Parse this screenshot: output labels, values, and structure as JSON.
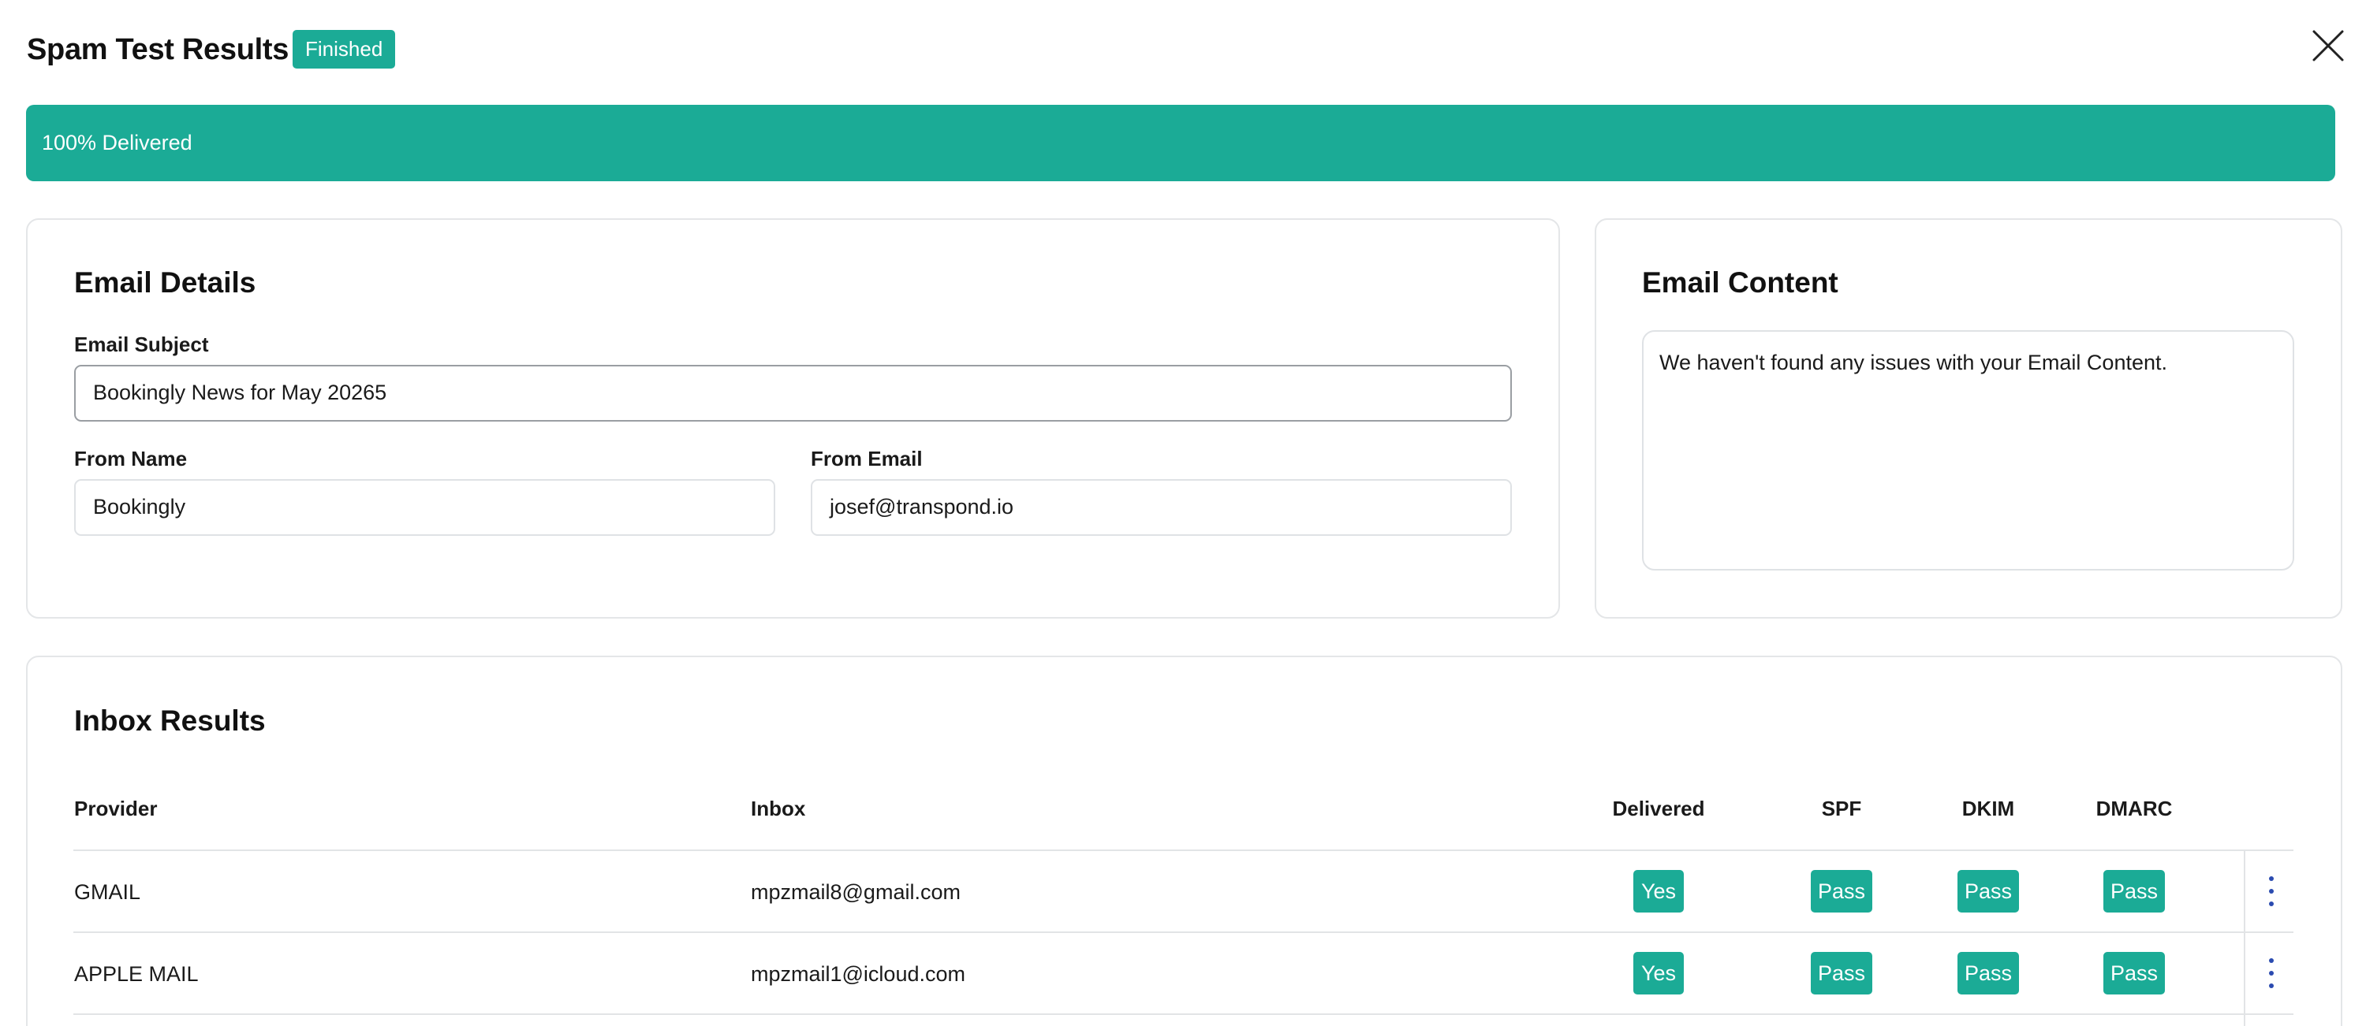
{
  "header": {
    "title": "Spam Test Results",
    "status_badge": "Finished"
  },
  "banner": {
    "text": "100% Delivered",
    "delivered_percent": 100
  },
  "email_details": {
    "title": "Email Details",
    "subject_label": "Email Subject",
    "subject_value": "Bookingly News for May 20265",
    "from_name_label": "From Name",
    "from_name_value": "Bookingly",
    "from_email_label": "From Email",
    "from_email_value": "josef@transpond.io"
  },
  "email_content": {
    "title": "Email Content",
    "message": "We haven't found any issues with your Email Content."
  },
  "inbox_results": {
    "title": "Inbox Results",
    "columns": {
      "provider": "Provider",
      "inbox": "Inbox",
      "delivered": "Delivered",
      "spf": "SPF",
      "dkim": "DKIM",
      "dmarc": "DMARC"
    },
    "rows": [
      {
        "provider": "GMAIL",
        "inbox": "mpzmail8@gmail.com",
        "delivered": "Yes",
        "spf": "Pass",
        "dkim": "Pass",
        "dmarc": "Pass"
      },
      {
        "provider": "APPLE MAIL",
        "inbox": "mpzmail1@icloud.com",
        "delivered": "Yes",
        "spf": "Pass",
        "dkim": "Pass",
        "dmarc": "Pass"
      }
    ]
  },
  "colors": {
    "accent": "#1bab96",
    "kebab": "#2b4bb0",
    "border": "#e4e6e8"
  },
  "icons": {
    "close": "close-icon",
    "row_menu": "more-vertical-icon"
  }
}
